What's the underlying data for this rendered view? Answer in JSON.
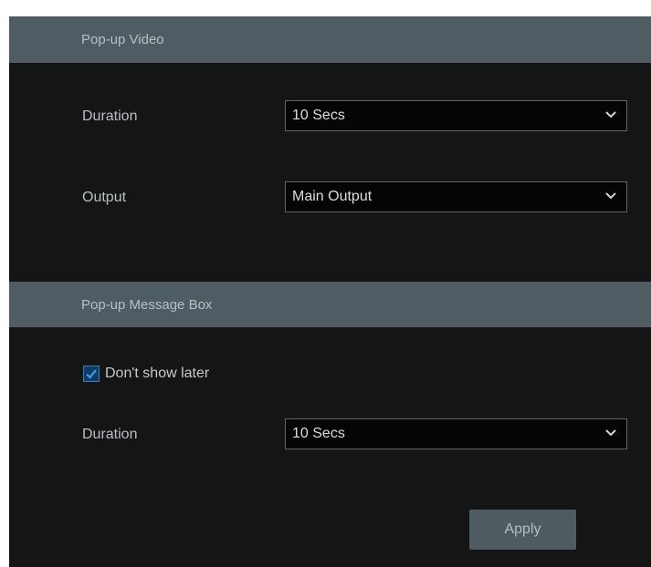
{
  "popup_video": {
    "title": "Pop-up Video",
    "duration_label": "Duration",
    "duration_value": "10 Secs",
    "output_label": "Output",
    "output_value": "Main Output"
  },
  "popup_message": {
    "title": "Pop-up Message Box",
    "dont_show_label": "Don't show later",
    "dont_show_checked": true,
    "duration_label": "Duration",
    "duration_value": "10 Secs"
  },
  "actions": {
    "apply_label": "Apply"
  },
  "icons": {
    "dropdown": "chevron-down-icon",
    "check": "checkmark-icon"
  },
  "colors": {
    "panel_bg": "#151515",
    "header_bg": "#4f5c63",
    "checkbox_accent": "#2e8bd8"
  }
}
